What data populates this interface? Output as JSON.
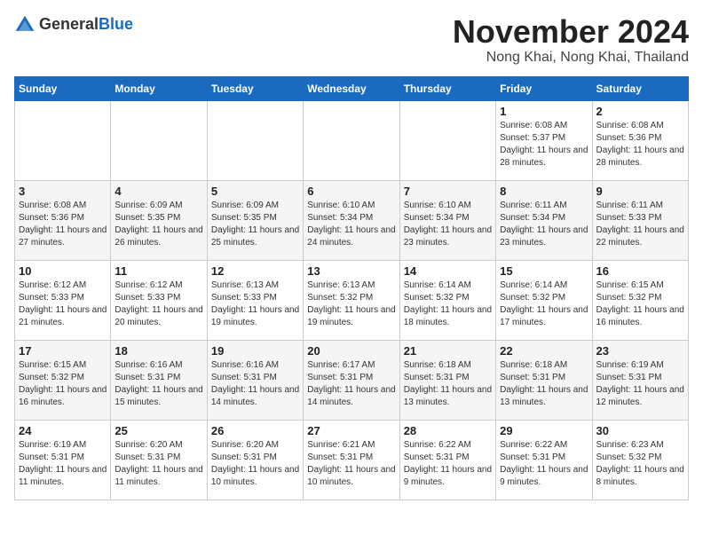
{
  "logo": {
    "text_general": "General",
    "text_blue": "Blue"
  },
  "title": {
    "month": "November 2024",
    "location": "Nong Khai, Nong Khai, Thailand"
  },
  "weekdays": [
    "Sunday",
    "Monday",
    "Tuesday",
    "Wednesday",
    "Thursday",
    "Friday",
    "Saturday"
  ],
  "weeks": [
    [
      {
        "day": "",
        "info": ""
      },
      {
        "day": "",
        "info": ""
      },
      {
        "day": "",
        "info": ""
      },
      {
        "day": "",
        "info": ""
      },
      {
        "day": "",
        "info": ""
      },
      {
        "day": "1",
        "info": "Sunrise: 6:08 AM\nSunset: 5:37 PM\nDaylight: 11 hours and 28 minutes."
      },
      {
        "day": "2",
        "info": "Sunrise: 6:08 AM\nSunset: 5:36 PM\nDaylight: 11 hours and 28 minutes."
      }
    ],
    [
      {
        "day": "3",
        "info": "Sunrise: 6:08 AM\nSunset: 5:36 PM\nDaylight: 11 hours and 27 minutes."
      },
      {
        "day": "4",
        "info": "Sunrise: 6:09 AM\nSunset: 5:35 PM\nDaylight: 11 hours and 26 minutes."
      },
      {
        "day": "5",
        "info": "Sunrise: 6:09 AM\nSunset: 5:35 PM\nDaylight: 11 hours and 25 minutes."
      },
      {
        "day": "6",
        "info": "Sunrise: 6:10 AM\nSunset: 5:34 PM\nDaylight: 11 hours and 24 minutes."
      },
      {
        "day": "7",
        "info": "Sunrise: 6:10 AM\nSunset: 5:34 PM\nDaylight: 11 hours and 23 minutes."
      },
      {
        "day": "8",
        "info": "Sunrise: 6:11 AM\nSunset: 5:34 PM\nDaylight: 11 hours and 23 minutes."
      },
      {
        "day": "9",
        "info": "Sunrise: 6:11 AM\nSunset: 5:33 PM\nDaylight: 11 hours and 22 minutes."
      }
    ],
    [
      {
        "day": "10",
        "info": "Sunrise: 6:12 AM\nSunset: 5:33 PM\nDaylight: 11 hours and 21 minutes."
      },
      {
        "day": "11",
        "info": "Sunrise: 6:12 AM\nSunset: 5:33 PM\nDaylight: 11 hours and 20 minutes."
      },
      {
        "day": "12",
        "info": "Sunrise: 6:13 AM\nSunset: 5:33 PM\nDaylight: 11 hours and 19 minutes."
      },
      {
        "day": "13",
        "info": "Sunrise: 6:13 AM\nSunset: 5:32 PM\nDaylight: 11 hours and 19 minutes."
      },
      {
        "day": "14",
        "info": "Sunrise: 6:14 AM\nSunset: 5:32 PM\nDaylight: 11 hours and 18 minutes."
      },
      {
        "day": "15",
        "info": "Sunrise: 6:14 AM\nSunset: 5:32 PM\nDaylight: 11 hours and 17 minutes."
      },
      {
        "day": "16",
        "info": "Sunrise: 6:15 AM\nSunset: 5:32 PM\nDaylight: 11 hours and 16 minutes."
      }
    ],
    [
      {
        "day": "17",
        "info": "Sunrise: 6:15 AM\nSunset: 5:32 PM\nDaylight: 11 hours and 16 minutes."
      },
      {
        "day": "18",
        "info": "Sunrise: 6:16 AM\nSunset: 5:31 PM\nDaylight: 11 hours and 15 minutes."
      },
      {
        "day": "19",
        "info": "Sunrise: 6:16 AM\nSunset: 5:31 PM\nDaylight: 11 hours and 14 minutes."
      },
      {
        "day": "20",
        "info": "Sunrise: 6:17 AM\nSunset: 5:31 PM\nDaylight: 11 hours and 14 minutes."
      },
      {
        "day": "21",
        "info": "Sunrise: 6:18 AM\nSunset: 5:31 PM\nDaylight: 11 hours and 13 minutes."
      },
      {
        "day": "22",
        "info": "Sunrise: 6:18 AM\nSunset: 5:31 PM\nDaylight: 11 hours and 13 minutes."
      },
      {
        "day": "23",
        "info": "Sunrise: 6:19 AM\nSunset: 5:31 PM\nDaylight: 11 hours and 12 minutes."
      }
    ],
    [
      {
        "day": "24",
        "info": "Sunrise: 6:19 AM\nSunset: 5:31 PM\nDaylight: 11 hours and 11 minutes."
      },
      {
        "day": "25",
        "info": "Sunrise: 6:20 AM\nSunset: 5:31 PM\nDaylight: 11 hours and 11 minutes."
      },
      {
        "day": "26",
        "info": "Sunrise: 6:20 AM\nSunset: 5:31 PM\nDaylight: 11 hours and 10 minutes."
      },
      {
        "day": "27",
        "info": "Sunrise: 6:21 AM\nSunset: 5:31 PM\nDaylight: 11 hours and 10 minutes."
      },
      {
        "day": "28",
        "info": "Sunrise: 6:22 AM\nSunset: 5:31 PM\nDaylight: 11 hours and 9 minutes."
      },
      {
        "day": "29",
        "info": "Sunrise: 6:22 AM\nSunset: 5:31 PM\nDaylight: 11 hours and 9 minutes."
      },
      {
        "day": "30",
        "info": "Sunrise: 6:23 AM\nSunset: 5:32 PM\nDaylight: 11 hours and 8 minutes."
      }
    ]
  ]
}
